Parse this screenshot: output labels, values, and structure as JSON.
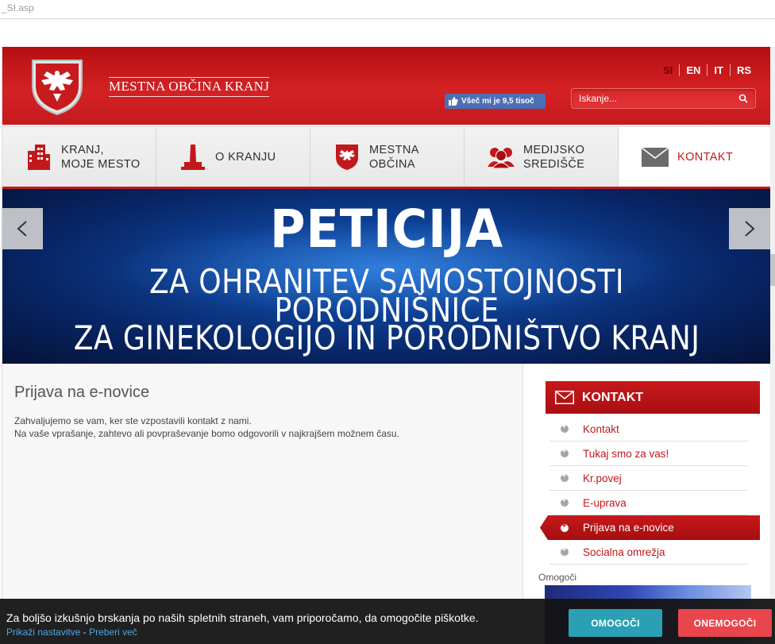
{
  "browser": {
    "url_fragment": "_SI.asp"
  },
  "header": {
    "site_title": "MESTNA OBČINA KRANJ",
    "languages": [
      "SI",
      "EN",
      "IT",
      "RS"
    ],
    "facebook_like": "Všeč mi je 9,5 tisoč",
    "search_placeholder": "Iskanje..."
  },
  "nav": {
    "items": [
      {
        "line1": "KRANJ,",
        "line2": "MOJE MESTO",
        "icon": "buildings-icon"
      },
      {
        "line1": "O KRANJU",
        "line2": "",
        "icon": "tower-icon"
      },
      {
        "line1": "MESTNA",
        "line2": "OBČINA",
        "icon": "eagle-crest-icon"
      },
      {
        "line1": "MEDIJSKO",
        "line2": "SREDIŠČE",
        "icon": "people-icon"
      },
      {
        "line1": "KONTAKT",
        "line2": "",
        "icon": "envelope-icon"
      }
    ]
  },
  "banner": {
    "title": "PETICIJA",
    "line1": "ZA OHRANITEV SAMOSTOJNOSTI",
    "line2": "PORODNIŠNICE",
    "line3": "ZA GINEKOLOGIJO IN PORODNIŠTVO KRANJ",
    "prev": "<",
    "next": ">"
  },
  "main": {
    "heading": "Prijava na e-novice",
    "para1": "Zahvaljujemo se vam, ker ste vzpostavili kontakt z nami.",
    "para2": "Na vaše vprašanje, zahtevo ali povpraševanje bomo odgovorili v najkrajšem možnem času."
  },
  "sidebar": {
    "heading": "KONTAKT",
    "items": [
      "Kontakt",
      "Tukaj smo za vas!",
      "Kr.povej",
      "E-uprava",
      "Prijava na e-novice",
      "Socialna omrežja"
    ],
    "active_index": 4,
    "enabled_by": "Omogoči"
  },
  "cookie": {
    "message": "Za boljšo izkušnjo brskanja po naših spletnih straneh, vam priporočamo, da omogočite piškotke.",
    "show_settings": "Prikaži nastavitve",
    "separator": "-",
    "read_more": "Preberi več",
    "accept": "OMOGOČI",
    "decline": "ONEMOGOČI"
  },
  "colors": {
    "brand_red": "#c3181b",
    "accept": "#2ba0b5",
    "decline": "#e8454c",
    "link": "#4ea8de"
  }
}
